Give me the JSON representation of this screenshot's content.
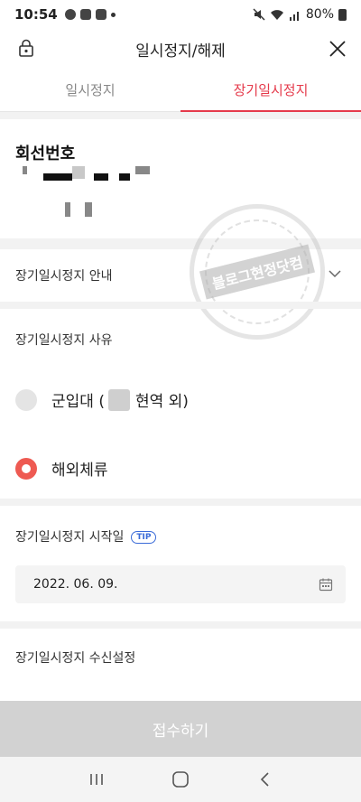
{
  "status_bar": {
    "time": "10:54",
    "battery": "80%"
  },
  "header": {
    "title": "일시정지/해제"
  },
  "tabs": [
    {
      "label": "일시정지",
      "active": false
    },
    {
      "label": "장기일시정지",
      "active": true
    }
  ],
  "line": {
    "title": "회선번호"
  },
  "watermark": {
    "text": "블로그현정닷컴"
  },
  "guide": {
    "label": "장기일시정지 안내"
  },
  "reason": {
    "label": "장기일시정지 사유",
    "options": [
      {
        "prefix": "군입대 (",
        "suffix": "현역 외)",
        "selected": false
      },
      {
        "label": "해외체류",
        "selected": true
      }
    ]
  },
  "start": {
    "label": "장기일시정지 시작일",
    "tip": "TIP",
    "date": "2022. 06. 09."
  },
  "receive": {
    "label": "장기일시정지 수신설정"
  },
  "submit": {
    "label": "접수하기"
  },
  "colors": {
    "accent": "#e53a4b",
    "radio_on": "#ee5a52",
    "tip": "#3a6bd8",
    "disabled": "#d2d2d2"
  }
}
